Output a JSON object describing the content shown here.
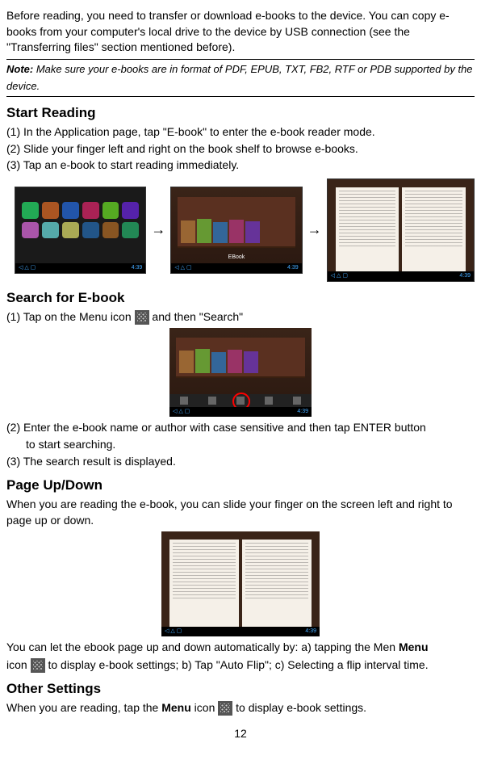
{
  "intro": "Before reading, you need to transfer or download e-books to the device. You can copy e-books from your computer's local drive to the device by USB connection (see the \"Transferring files\" section mentioned before).",
  "note_label": "Note:",
  "note_text": " Make sure your e-books are in format of PDF, EPUB, TXT, FB2, RTF or PDB supported by the device.",
  "sections": {
    "start_reading": {
      "title": "Start Reading",
      "steps": [
        "(1) In the Application page, tap \"E-book\" to enter the e-book reader mode.",
        "(2) Slide your finger left and right on the book shelf to browse e-books.",
        "(3) Tap an e-book to start reading immediately."
      ],
      "ebook_label": "EBook",
      "time": "4:39"
    },
    "search": {
      "title": "Search for E-book",
      "step1_prefix": "(1) Tap on the Menu icon ",
      "step1_suffix": " and then \"Search\"",
      "step2": "(2) Enter the e-book name or author with case sensitive and then tap ENTER button",
      "step2_cont": "to start searching.",
      "step3": "(3) The search result is displayed."
    },
    "page_updown": {
      "title": "Page Up/Down",
      "para": "When you are reading the e-book, you can slide your finger on the screen left and right to page up or down.",
      "auto_prefix": "You can let the ebook page up and down automatically by: a) tapping the Men ",
      "auto_menu": "Menu",
      "auto_mid_prefix": "icon ",
      "auto_suffix": " to display e-book settings; b) Tap \"Auto Flip\"; c) Selecting a flip interval time."
    },
    "other": {
      "title": "Other Settings",
      "text_prefix": "When you are reading, tap the ",
      "text_menu": "Menu",
      "text_mid": " icon ",
      "text_suffix": " to display e-book settings."
    }
  },
  "page_number": "12"
}
